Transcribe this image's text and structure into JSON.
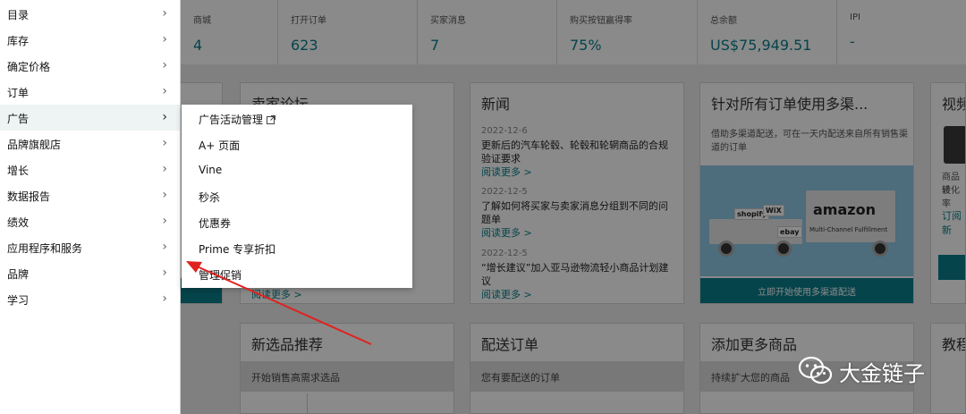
{
  "sidebar": {
    "items": [
      {
        "label": "目录"
      },
      {
        "label": "库存"
      },
      {
        "label": "确定价格"
      },
      {
        "label": "订单"
      },
      {
        "label": "广告"
      },
      {
        "label": "品牌旗舰店"
      },
      {
        "label": "增长"
      },
      {
        "label": "数据报告"
      },
      {
        "label": "绩效"
      },
      {
        "label": "应用程序和服务"
      },
      {
        "label": "品牌"
      },
      {
        "label": "学习"
      }
    ],
    "chevron": "›",
    "active_index": 4
  },
  "flyout": {
    "items": [
      {
        "label": "广告活动管理",
        "icon": "external-link-icon"
      },
      {
        "label": "A+ 页面"
      },
      {
        "label": "Vine"
      },
      {
        "label": "秒杀"
      },
      {
        "label": "优惠券"
      },
      {
        "label": "Prime 专享折扣"
      },
      {
        "label": "管理促销"
      }
    ]
  },
  "metrics": [
    {
      "label": "商城",
      "value": "4"
    },
    {
      "label": "打开订单",
      "value": "623"
    },
    {
      "label": "买家消息",
      "value": "7"
    },
    {
      "label": "购买按钮赢得率",
      "value": "75%"
    },
    {
      "label": "总余额",
      "value": "US$75,949.51"
    },
    {
      "label": "IPI",
      "value": "-"
    }
  ],
  "cards": {
    "forum": {
      "title": "卖家论坛",
      "more": "阅读更多 >"
    },
    "news": {
      "title": "新闻",
      "items": [
        {
          "date": "2022-12-6",
          "text": "更新后的汽车轮毂、轮毂和轮辋商品的合规验证要求",
          "more": "阅读更多 >"
        },
        {
          "date": "2022-12-5",
          "text": "了解如何将买家与卖家消息分组到不同的问题单",
          "more": "阅读更多 >"
        },
        {
          "date": "2022-12-5",
          "text": "“增长建议”加入亚马逊物流轻小商品计划建议",
          "more": "阅读更多 >"
        }
      ]
    },
    "mcf": {
      "title": "针对所有订单使用多渠...",
      "desc": "借助多渠道配送，可在一天内配送来自所有销售渠道的订单",
      "cta": "立即开始使用多渠道配送",
      "truck_brand": "amazon",
      "truck_sub": "Multi-Channel Fulfillment",
      "logos": [
        "shopify",
        "WiX",
        "ebay"
      ]
    },
    "video": {
      "title": "视频",
      "desc_lines": [
        "商品设",
        "转化率"
      ],
      "link": "订阅新"
    },
    "new_products": {
      "title": "新选品推荐",
      "subtitle": "开始销售高需求选品"
    },
    "ship_orders": {
      "title": "配送订单",
      "subtitle": "您有要配送的订单"
    },
    "add_products": {
      "title": "添加更多商品",
      "subtitle": "持续扩大您的商品"
    },
    "tutorial": {
      "title": "教程"
    }
  },
  "watermark": {
    "text": "大金链子",
    "icon": "wechat-icon"
  },
  "colors": {
    "accent": "#0a7f8b",
    "annotation_arrow": "#e0221f"
  }
}
